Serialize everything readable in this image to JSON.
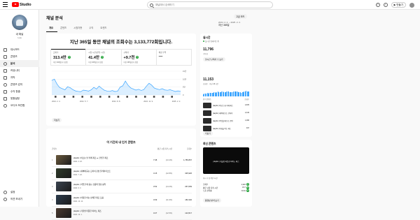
{
  "app": {
    "logo_text": "Studio"
  },
  "search": {
    "placeholder": "채널에서 검색하기"
  },
  "header": {
    "create_label": "만들기"
  },
  "sidebar": {
    "channel_label": "내 채널",
    "channel_name": "Loa",
    "items": [
      {
        "label": "대시보드",
        "icon": "dashboard-icon"
      },
      {
        "label": "콘텐츠",
        "icon": "content-icon"
      },
      {
        "label": "분석",
        "icon": "analytics-icon",
        "active": true
      },
      {
        "label": "커뮤니티",
        "icon": "community-icon"
      },
      {
        "label": "자막",
        "icon": "subtitles-icon"
      },
      {
        "label": "콘텐츠 감지",
        "icon": "copyright-icon"
      },
      {
        "label": "수익 창출",
        "icon": "monetization-icon"
      },
      {
        "label": "맞춤설정",
        "icon": "customization-icon"
      },
      {
        "label": "오디오 보관함",
        "icon": "audio-library-icon"
      }
    ],
    "bottom_items": [
      {
        "label": "설정",
        "icon": "settings-icon"
      },
      {
        "label": "의견 보내기",
        "icon": "feedback-icon"
      }
    ]
  },
  "page": {
    "title": "채널 분석",
    "advanced_label": "고급 모드",
    "date_range": "2024. 2. 4. – 2025. 2. 2.",
    "date_preset": "지난 365일",
    "tabs": [
      "개요",
      "콘텐츠",
      "시청자층",
      "수익",
      "트렌드"
    ],
    "active_tab": 0
  },
  "overview": {
    "headline": "지난 365일 동안 채널의 조회수는 3,133,772회입니다.",
    "kpis": [
      {
        "label": "조회수",
        "value": "313.4만",
        "trend": "up",
        "sub": "이전 365일보다 많음"
      },
      {
        "label": "시청 시간(단위: 시간)",
        "value": "41.4만",
        "trend": "up",
        "sub": "이전 365일보다 많음"
      },
      {
        "label": "구독자",
        "value": "+9.7천",
        "trend": "up",
        "sub": "이전 365일보다 많음"
      },
      {
        "label": "예상 수익",
        "value": "—",
        "trend": "",
        "sub": ""
      }
    ],
    "chart_y_ticks": [
      "15만",
      "10만",
      "5만",
      "0"
    ],
    "chart_x_ticks": [
      "2024. 2. 4.",
      "2024. 5. 7.",
      "2024. 8. 8.",
      "2024. 11. 9.",
      "2025. 2. 2."
    ],
    "more_label": "더보기"
  },
  "chart_data": {
    "type": "area",
    "ylabel": "",
    "ylim": [
      0,
      150000
    ],
    "series": [
      {
        "name": "",
        "values": [
          92000,
          100000,
          68000,
          47000,
          40000,
          33000,
          52000,
          46000,
          34000,
          26000,
          23000,
          21000,
          31000,
          28000,
          25000,
          33000,
          48000,
          38000,
          56000,
          42000,
          30000,
          25000,
          23000,
          28000,
          22000,
          24000,
          50000,
          58000,
          88000,
          62000,
          45000,
          38000,
          31000,
          36000,
          29000,
          34000,
          56000,
          74000,
          62000,
          44000,
          38000,
          34000,
          40000,
          32000,
          30000,
          33000,
          28000,
          22000,
          26000,
          23000
        ]
      }
    ]
  },
  "top_content": {
    "title": "이 기간의 내 인기 콘텐츠",
    "columns": [
      "콘텐츠",
      "평균 시청 지속 시간",
      "조회수"
    ],
    "rows": [
      {
        "rank": "1",
        "title": "playlist | 비오는 날 카페 재즈 ☕ 잔잔한 재즈",
        "date": "2024. 4. 18.",
        "duration": "7:38",
        "percent": "(13.4%)",
        "views": "1,786,867",
        "thumb": "#6b5a3e"
      },
      {
        "rank": "2",
        "title": "playlist | 새벽에 듣는 로파이 감성 플레이리스트",
        "date": "2024. 7. 22.",
        "duration": "4:15",
        "percent": "(12.8%)",
        "views": "325,926",
        "thumb": "#2f3a2a"
      },
      {
        "rank": "3",
        "title": "playlist | 작업할 때 듣는 집중력 향상 음악",
        "date": "2024. 9. 3.",
        "duration": "3:52",
        "percent": "(14.2%)",
        "views": "267,069",
        "thumb": "#3b4450"
      },
      {
        "rank": "4",
        "title": "playlist | 아침을 여는 상쾌한 재즈 모음",
        "date": "2024. 10. 14.",
        "duration": "3:09",
        "percent": "(11.9%)",
        "views": "182,340",
        "thumb": "#2c3b4d"
      },
      {
        "rank": "5",
        "title": "playlist | 겨울밤 따뜻한 피아노 재즈",
        "date": "2024. 12. 1.",
        "duration": "3:27",
        "percent": "(12.5%)",
        "views": "124,517",
        "thumb": "#4a3a30"
      }
    ]
  },
  "realtime": {
    "title": "실시간",
    "live_label": "실시간 업데이트 중",
    "subs_value": "11,796",
    "subs_label": "구독자",
    "subs_button": "실시간 구독자 수 보기",
    "views_value": "11,153",
    "views_label": "조회수 · 지난 48시간",
    "list_head_left": "인기 콘텐츠",
    "list_head_right": "조회수",
    "bars": [
      0.35,
      0.4,
      0.38,
      0.45,
      0.5,
      0.42,
      0.48,
      0.55,
      0.5,
      0.46,
      0.52,
      0.6,
      0.58,
      0.54,
      0.62,
      0.66,
      0.6,
      0.56,
      0.64,
      0.7,
      0.66,
      0.6,
      0.58,
      0.62,
      0.68,
      0.72,
      0.7,
      0.65,
      0.6,
      0.58,
      0.62,
      0.66,
      0.7,
      0.75,
      0.72,
      0.68,
      0.64,
      0.6,
      0.58,
      0.55,
      0.6,
      0.64,
      0.68,
      0.72,
      0.78,
      0.74,
      0.7,
      0.66
    ],
    "items": [
      {
        "title": "playlist | 비오는 날 카페 재즈",
        "views": "4,876"
      },
      {
        "title": "playlist | 새벽에 듣는 로파이",
        "views": "2,132"
      },
      {
        "title": "playlist | 작업할 때 듣는 음악",
        "views": "1,460"
      },
      {
        "title": "playlist | 아침을 여는 재즈",
        "views": "917"
      }
    ],
    "more_label": "더보기"
  },
  "latest": {
    "title": "최신 콘텐츠",
    "caption": "playlist | 겨울밤 따뜻한 피아노 재즈",
    "date": "게시 후 첫 3일 3시간",
    "rows": [
      {
        "label": "조회수",
        "value": "1,322"
      },
      {
        "label": "평균 시청 지속 시간",
        "value": "3:17"
      },
      {
        "label": "노출 클릭률",
        "value": "8.1%"
      }
    ],
    "button": "동영상 분석 보기"
  }
}
